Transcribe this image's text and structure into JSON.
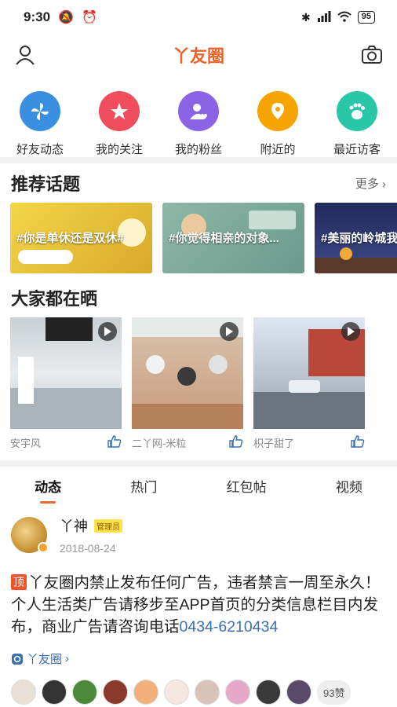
{
  "status": {
    "time": "9:30",
    "battery": "95"
  },
  "header": {
    "title": "丫友圈"
  },
  "quick_actions": [
    {
      "label": "好友动态",
      "icon": "pinwheel-icon",
      "color": "#3b8fe0"
    },
    {
      "label": "我的关注",
      "icon": "star-icon",
      "color": "#f04d5f"
    },
    {
      "label": "我的粉丝",
      "icon": "user-heart-icon",
      "color": "#8a63e6"
    },
    {
      "label": "附近的",
      "icon": "location-icon",
      "color": "#f5a400"
    },
    {
      "label": "最近访客",
      "icon": "footprint-icon",
      "color": "#28c7a8"
    }
  ],
  "topics": {
    "title": "推荐话题",
    "more": "更多",
    "items": [
      {
        "text": "#你是单休还是双休#",
        "color": "#e8c33a"
      },
      {
        "text": "#你觉得相亲的对象...",
        "color": "#7fa89a"
      },
      {
        "text": "#美丽的岭城我",
        "color": "#2c3a6a"
      }
    ]
  },
  "sharing": {
    "title": "大家都在晒",
    "items": [
      {
        "author": "安宇风"
      },
      {
        "author": "二丫网-米粒"
      },
      {
        "author": "枳子甜了"
      }
    ]
  },
  "tabs": [
    "动态",
    "热门",
    "红包帖",
    "视频"
  ],
  "post": {
    "author": "丫神",
    "badge": "管理员",
    "date": "2018-08-24",
    "top_tag": "顶",
    "body": "丫友圈内禁止发布任何广告，违者禁言一周至永久！个人生活类广告请移步至APP首页的分类信息栏目内发布，商业广告请咨询电话",
    "phone": "0434-6210434",
    "circle": "丫友圈",
    "likes": "93赞"
  }
}
